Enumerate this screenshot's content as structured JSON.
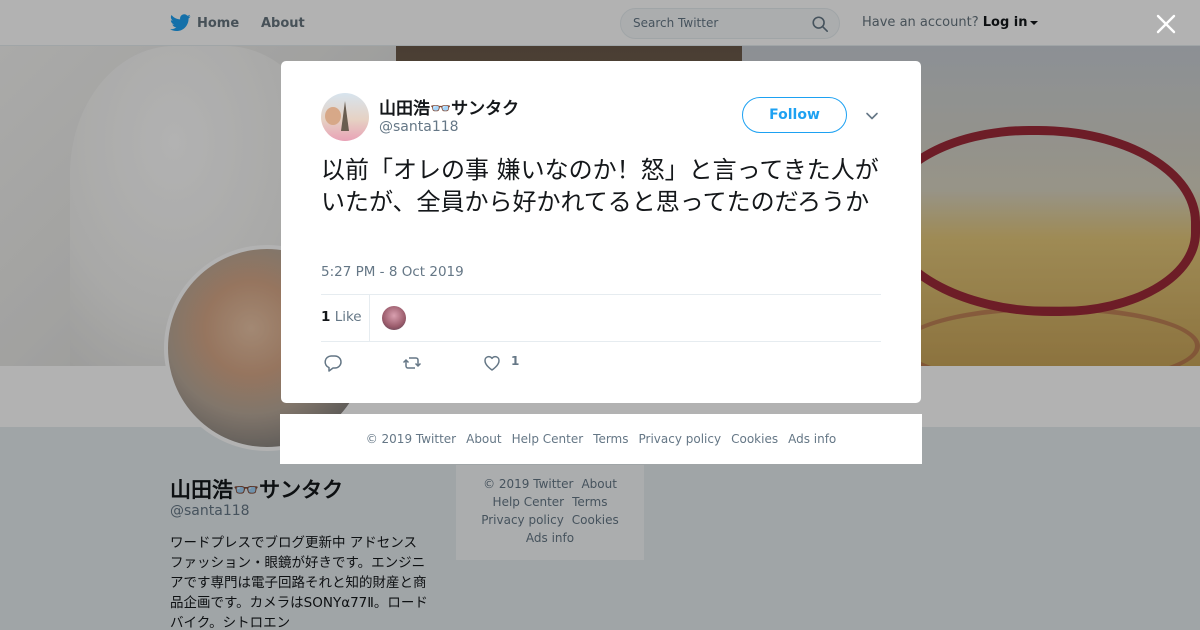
{
  "header": {
    "home_label": "Home",
    "about_label": "About",
    "search_placeholder": "Search Twitter",
    "account_prompt": "Have an account?",
    "login_label": "Log in"
  },
  "profile": {
    "name": "山田浩👓サンタク",
    "handle": "@santa118",
    "bio": "ワードプレスでブログ更新中 アドセンス　ファッション・眼鏡が好きです。エンジニアです専門は電子回路それと知的財産と商品企画です。カメラはSONYα77Ⅱ。ロードバイク。シトロエン"
  },
  "side_footer": {
    "links": [
      "© 2019 Twitter",
      "About",
      "Help Center",
      "Terms",
      "Privacy policy",
      "Cookies",
      "Ads info"
    ]
  },
  "tweet": {
    "author_name": "山田浩👓サンタク",
    "author_handle": "@santa118",
    "follow_label": "Follow",
    "text": "以前「オレの事 嫌いなのか！怒」と言ってきた人がいたが、全員から好かれてると思ってたのだろうか",
    "timestamp": "5:27 PM - 8 Oct 2019",
    "like_count": "1",
    "like_label": "Like",
    "action_like_count": "1"
  },
  "modal_footer": {
    "links": [
      "© 2019 Twitter",
      "About",
      "Help Center",
      "Terms",
      "Privacy policy",
      "Cookies",
      "Ads info"
    ]
  },
  "colors": {
    "brand": "#1da1f2",
    "text": "#14171a",
    "muted": "#657786"
  },
  "icons": [
    "twitter-bird-icon",
    "search-icon",
    "caret-down-icon",
    "close-icon",
    "chevron-down-icon",
    "reply-icon",
    "retweet-icon",
    "heart-icon"
  ]
}
